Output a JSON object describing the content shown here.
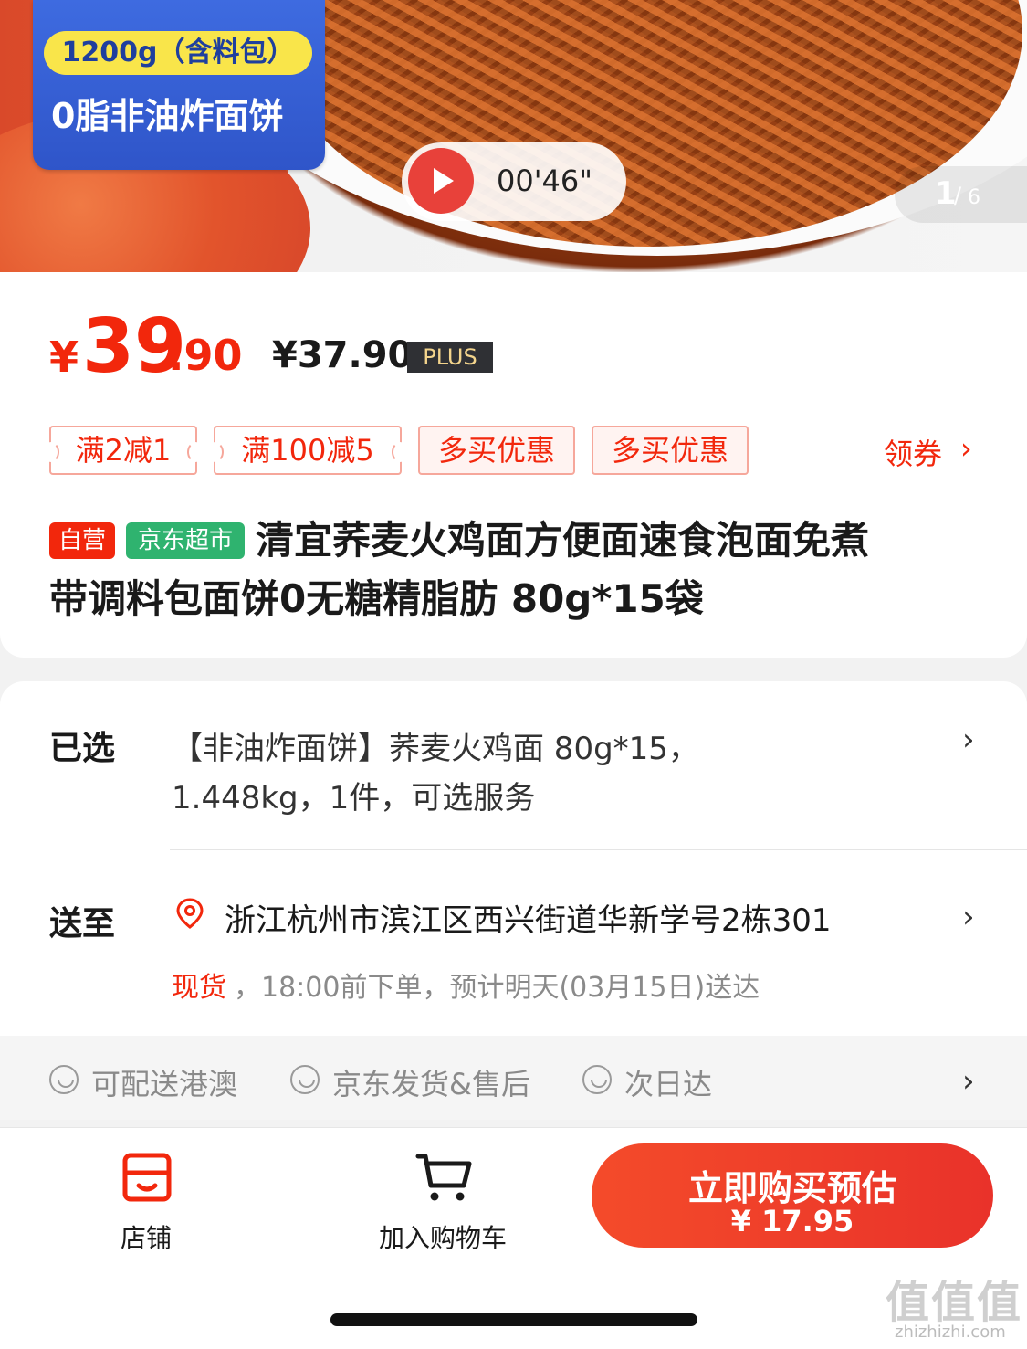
{
  "hero": {
    "weight_badge": "1200g（含料包）",
    "feature_text": "0脂非油炸面饼",
    "video_duration": "00'46\"",
    "pager_current": "1",
    "pager_separator": "/",
    "pager_total": "6"
  },
  "price": {
    "symbol": "¥",
    "integer": "39",
    "decimal": ".90",
    "plus_price": "¥37.90",
    "plus_tag": "PLUS"
  },
  "promotions": [
    {
      "label": "满2减1"
    },
    {
      "label": "满100减5"
    },
    {
      "label": "多买优惠"
    },
    {
      "label": "多买优惠"
    }
  ],
  "coupon": {
    "label": "领券",
    "chevron": "›"
  },
  "product": {
    "tag_self": "自营",
    "tag_market": "京东超市",
    "title_line1": "清宜荞麦火鸡面方便面速食泡面免煮",
    "title_line2": "带调料包面饼0无糖精脂肪 80g*15袋"
  },
  "selection": {
    "label": "已选",
    "line1": "【非油炸面饼】荞麦火鸡面 80g*15，",
    "line2": "1.448kg，1件，可选服务",
    "chevron": "›"
  },
  "delivery": {
    "label": "送至",
    "icon": "location-pin-icon",
    "address": "浙江杭州市滨江区西兴街道华新学号2栋301",
    "stock": "现货",
    "eta": "，18:00前下单，预计明天(03月15日)送达",
    "chevron": "›"
  },
  "services": {
    "items": [
      {
        "label": "可配送港澳"
      },
      {
        "label": "京东发货&售后"
      },
      {
        "label": "次日达"
      }
    ],
    "chevron": "›"
  },
  "bottom": {
    "store_label": "店铺",
    "cart_label": "加入购物车",
    "buy_title": "立即购买预估",
    "buy_price": "¥ 17.95"
  },
  "watermark": {
    "text": "值值值",
    "url": "zhizhizhi.com"
  },
  "colors": {
    "accent": "#f2270c",
    "tag_green": "#2fb36f",
    "plus_bg": "#2f3034",
    "plus_text": "#f3d48c"
  }
}
